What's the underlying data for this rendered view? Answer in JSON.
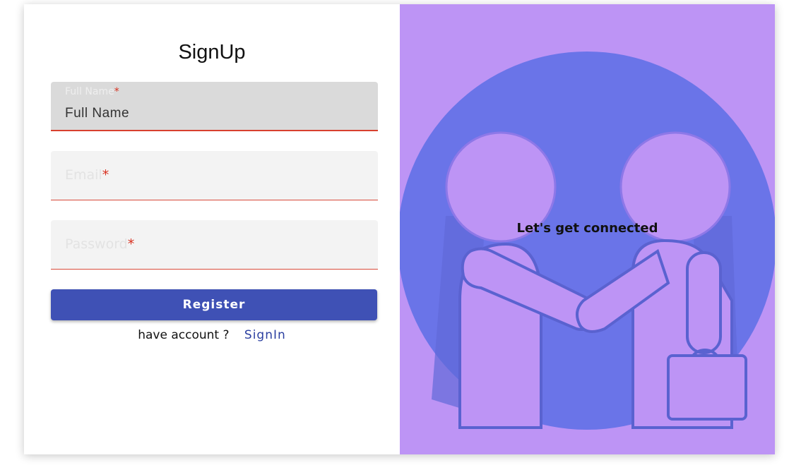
{
  "form": {
    "title": "SignUp",
    "full_name": {
      "label": "Full Name",
      "required_mark": "*",
      "value": "Full Name"
    },
    "email": {
      "placeholder": "Email",
      "required_mark": "*"
    },
    "password": {
      "placeholder": "Password",
      "required_mark": "*"
    },
    "register_label": "Register",
    "have_account_text": "have account ?",
    "signin_label": "SignIn"
  },
  "illustration": {
    "tagline": "Let's get connected",
    "icon": "handshake-illustration"
  },
  "colors": {
    "accent": "#3f51b5",
    "error": "#d8301f",
    "panel_bg": "#bd94f5",
    "circle": "#6a74e8"
  }
}
